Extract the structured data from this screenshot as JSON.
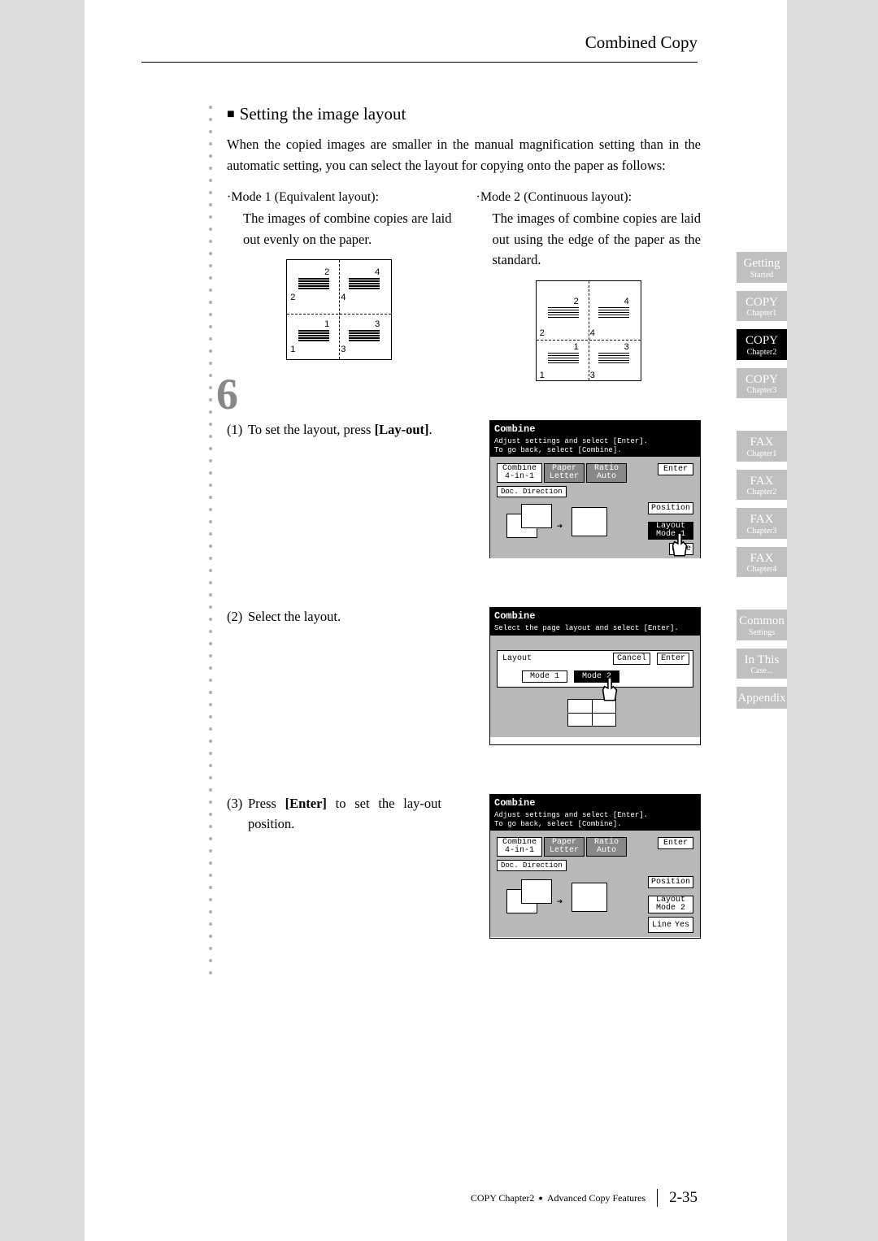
{
  "header": {
    "title": "Combined Copy"
  },
  "section": {
    "heading": "Setting the image layout",
    "para": "When the copied images are smaller in the manual magnification setting than in the automatic setting, you can select the layout for copying onto the paper as follows:"
  },
  "modes": {
    "mode1": {
      "title": "·Mode 1 (Equivalent layout):",
      "desc": "The images of combine copies are laid out evenly on the paper."
    },
    "mode2": {
      "title": "·Mode 2 (Continuous layout):",
      "desc": "The images of combine copies are laid out using the edge of the paper as the standard."
    }
  },
  "big_step_num": "6",
  "steps": {
    "s1": {
      "num": "(1)",
      "text_a": "To set the layout, press ",
      "bold": "[Lay-out]",
      "text_b": "."
    },
    "s2": {
      "num": "(2)",
      "text_a": "Select the layout."
    },
    "s3": {
      "num": "(3)",
      "text_a": "Press ",
      "bold": "[Enter]",
      "text_b": " to set the lay-out position."
    }
  },
  "screens": {
    "title": "Combine",
    "sub1": "Adjust settings and select [Enter].\nTo go back, select [Combine].",
    "sub2": "Select the page layout and select [Enter].",
    "combine": "Combine",
    "four_in_one": "4-in-1",
    "paper": "Paper",
    "letter": "Letter",
    "ratio": "Ratio",
    "auto": "Auto",
    "enter": "Enter",
    "doc_dir": "Doc. Direction",
    "position": "Position",
    "layout": "Layout",
    "mode1": "Mode 1",
    "mode2": "Mode 2",
    "line": "Line",
    "yes": "Yes",
    "cancel": "Cancel"
  },
  "tabs": [
    {
      "t": "Getting",
      "s": "Started"
    },
    {
      "t": "COPY",
      "s": "Chapter1"
    },
    {
      "t": "COPY",
      "s": "Chapter2",
      "active": true
    },
    {
      "t": "COPY",
      "s": "Chapter3"
    },
    {
      "t": "FAX",
      "s": "Chapter1"
    },
    {
      "t": "FAX",
      "s": "Chapter2"
    },
    {
      "t": "FAX",
      "s": "Chapter3"
    },
    {
      "t": "FAX",
      "s": "Chapter4"
    },
    {
      "t": "Common",
      "s": "Settings"
    },
    {
      "t": "In This",
      "s": "Case..."
    },
    {
      "t": "Appendix",
      "s": ""
    }
  ],
  "footer": {
    "left": "COPY Chapter2",
    "right": "Advanced Copy Features",
    "page": "2-35"
  }
}
